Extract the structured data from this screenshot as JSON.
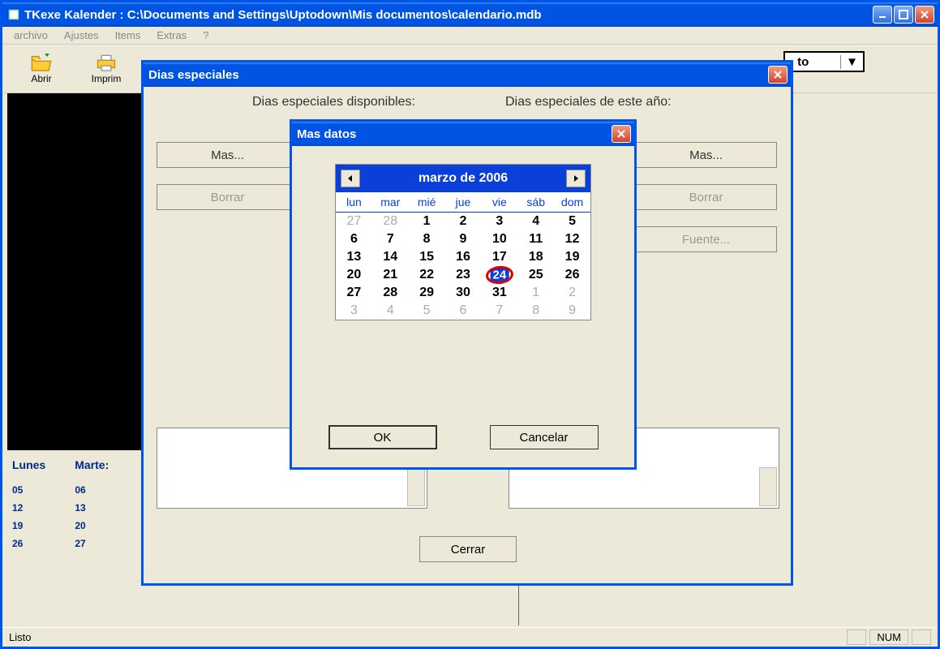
{
  "main": {
    "title": "TKexe Kalender : C:\\Documents and Settings\\Uptodown\\Mis documentos\\calendario.mdb"
  },
  "menu": {
    "archivo": "archivo",
    "ajustes": "Ajustes",
    "items": "Items",
    "extras": "Extras",
    "help": "?"
  },
  "toolbar": {
    "abrir": "Abrir",
    "imprim": "Imprim",
    "zoom": "to"
  },
  "preview": {
    "lunes": "Lunes",
    "martes": "Marte:",
    "rows": [
      [
        "05",
        "06"
      ],
      [
        "12",
        "13"
      ],
      [
        "19",
        "20"
      ],
      [
        "26",
        "27"
      ]
    ]
  },
  "status": {
    "listo": "Listo",
    "num": "NUM"
  },
  "dias": {
    "title": "Dias especiales",
    "label_left": "Dias especiales disponibles:",
    "label_right": "Dias especiales de este año:",
    "mas": "Mas...",
    "borrar": "Borrar",
    "fuente": "Fuente...",
    "cerrar": "Cerrar"
  },
  "masdatos": {
    "title": "Mas datos",
    "month": "marzo de 2006",
    "ok": "OK",
    "cancelar": "Cancelar",
    "dayheads": [
      "lun",
      "mar",
      "mié",
      "jue",
      "vie",
      "sáb",
      "dom"
    ],
    "weeks": [
      [
        {
          "n": "27",
          "m": true
        },
        {
          "n": "28",
          "m": true
        },
        {
          "n": "1"
        },
        {
          "n": "2"
        },
        {
          "n": "3"
        },
        {
          "n": "4"
        },
        {
          "n": "5"
        }
      ],
      [
        {
          "n": "6"
        },
        {
          "n": "7"
        },
        {
          "n": "8"
        },
        {
          "n": "9"
        },
        {
          "n": "10"
        },
        {
          "n": "11"
        },
        {
          "n": "12"
        }
      ],
      [
        {
          "n": "13"
        },
        {
          "n": "14"
        },
        {
          "n": "15"
        },
        {
          "n": "16"
        },
        {
          "n": "17"
        },
        {
          "n": "18"
        },
        {
          "n": "19"
        }
      ],
      [
        {
          "n": "20"
        },
        {
          "n": "21"
        },
        {
          "n": "22"
        },
        {
          "n": "23"
        },
        {
          "n": "24",
          "today": true
        },
        {
          "n": "25"
        },
        {
          "n": "26"
        }
      ],
      [
        {
          "n": "27"
        },
        {
          "n": "28"
        },
        {
          "n": "29"
        },
        {
          "n": "30"
        },
        {
          "n": "31"
        },
        {
          "n": "1",
          "m": true
        },
        {
          "n": "2",
          "m": true
        }
      ],
      [
        {
          "n": "3",
          "m": true
        },
        {
          "n": "4",
          "m": true
        },
        {
          "n": "5",
          "m": true
        },
        {
          "n": "6",
          "m": true
        },
        {
          "n": "7",
          "m": true
        },
        {
          "n": "8",
          "m": true
        },
        {
          "n": "9",
          "m": true
        }
      ]
    ]
  }
}
